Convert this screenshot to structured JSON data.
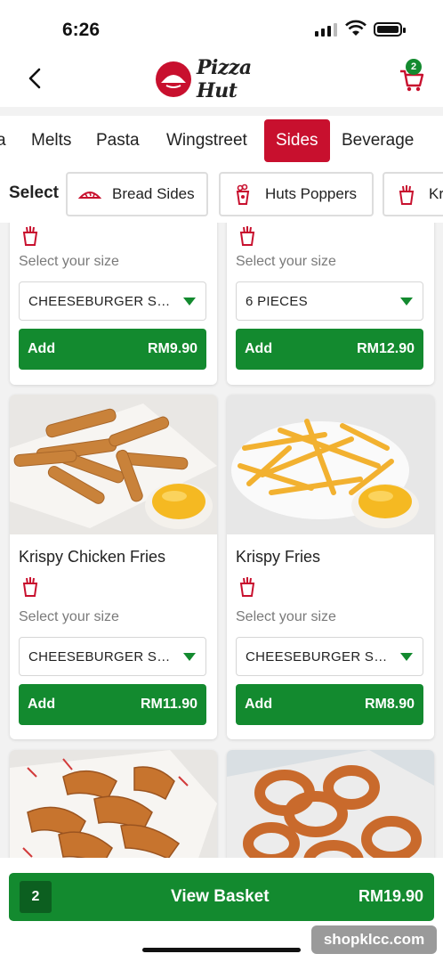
{
  "status_bar": {
    "time": "6:26"
  },
  "header": {
    "logo_text": "Pizza Hut",
    "cart_count": "2"
  },
  "categories": [
    {
      "label": "a"
    },
    {
      "label": "Melts"
    },
    {
      "label": "Pasta"
    },
    {
      "label": "Wingstreet"
    },
    {
      "label": "Sides",
      "active": true
    },
    {
      "label": "Beverage"
    }
  ],
  "subfilter": {
    "label": "Select",
    "chips": [
      {
        "label": "Bread Sides",
        "icon": "bread-icon"
      },
      {
        "label": "Huts Poppers",
        "icon": "poppers-icon"
      },
      {
        "label": "Kr",
        "icon": "fries-icon"
      }
    ]
  },
  "products": [
    {
      "name": "",
      "size_label": "Select your size",
      "size_value": "CHEESEBURGER SA...",
      "add_label": "Add",
      "price": "RM9.90"
    },
    {
      "name": "",
      "size_label": "Select your size",
      "size_value": "6 PIECES",
      "add_label": "Add",
      "price": "RM12.90"
    },
    {
      "name": "Krispy Chicken Fries",
      "size_label": "Select your size",
      "size_value": "CHEESEBURGER SA...",
      "add_label": "Add",
      "price": "RM11.90",
      "image": "chicken-fries-photo"
    },
    {
      "name": "Krispy Fries",
      "size_label": "Select your size",
      "size_value": "CHEESEBURGER SA...",
      "add_label": "Add",
      "price": "RM8.90",
      "image": "fries-photo"
    },
    {
      "name": "",
      "image": "wedges-photo"
    },
    {
      "name": "",
      "image": "onion-rings-photo"
    }
  ],
  "basket": {
    "count": "2",
    "label": "View Basket",
    "total": "RM19.90"
  },
  "watermark": "shopklcc.com",
  "colors": {
    "brand_red": "#c8102e",
    "action_green": "#138a2f"
  }
}
